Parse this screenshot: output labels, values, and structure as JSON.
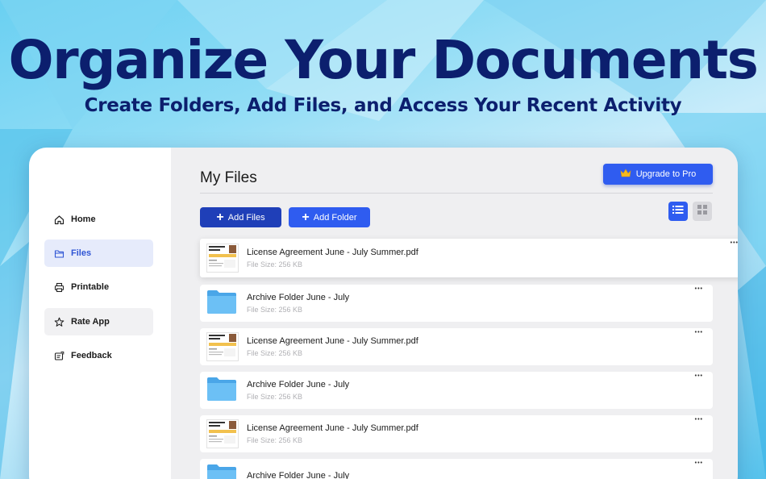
{
  "hero": {
    "title": "Organize Your Documents",
    "subtitle": "Create Folders, Add Files, and Access Your Recent Activity"
  },
  "sidebar": {
    "items": [
      {
        "label": "Home",
        "icon": "home-icon"
      },
      {
        "label": "Files",
        "icon": "folder-icon",
        "active": true
      },
      {
        "label": "Printable",
        "icon": "printer-icon"
      },
      {
        "label": "Rate App",
        "icon": "star-icon"
      },
      {
        "label": "Feedback",
        "icon": "feedback-icon"
      }
    ]
  },
  "main": {
    "title": "My Files",
    "upgrade_label": "Upgrade to Pro",
    "add_files_label": "Add Files",
    "add_folder_label": "Add Folder",
    "view_modes": [
      "list",
      "grid"
    ],
    "selected_view": "list",
    "files": [
      {
        "type": "pdf",
        "name": "License Agreement June - July Summer.pdf",
        "size": "File Size: 256 KB"
      },
      {
        "type": "folder",
        "name": "Archive Folder June - July",
        "size": "File Size: 256 KB"
      },
      {
        "type": "pdf",
        "name": "License Agreement June - July Summer.pdf",
        "size": "File Size: 256 KB"
      },
      {
        "type": "folder",
        "name": "Archive Folder June - July",
        "size": "File Size: 256 KB"
      },
      {
        "type": "pdf",
        "name": "License Agreement June - July Summer.pdf",
        "size": "File Size: 256 KB"
      },
      {
        "type": "folder",
        "name": "Archive Folder June - July",
        "size": ""
      }
    ]
  },
  "colors": {
    "hero_text": "#0c1f6e",
    "primary_button": "#2f5cf0",
    "add_files_button": "#1f3fb8",
    "active_nav_bg": "#e6ebfb",
    "folder_blue": "#5db4ef"
  }
}
